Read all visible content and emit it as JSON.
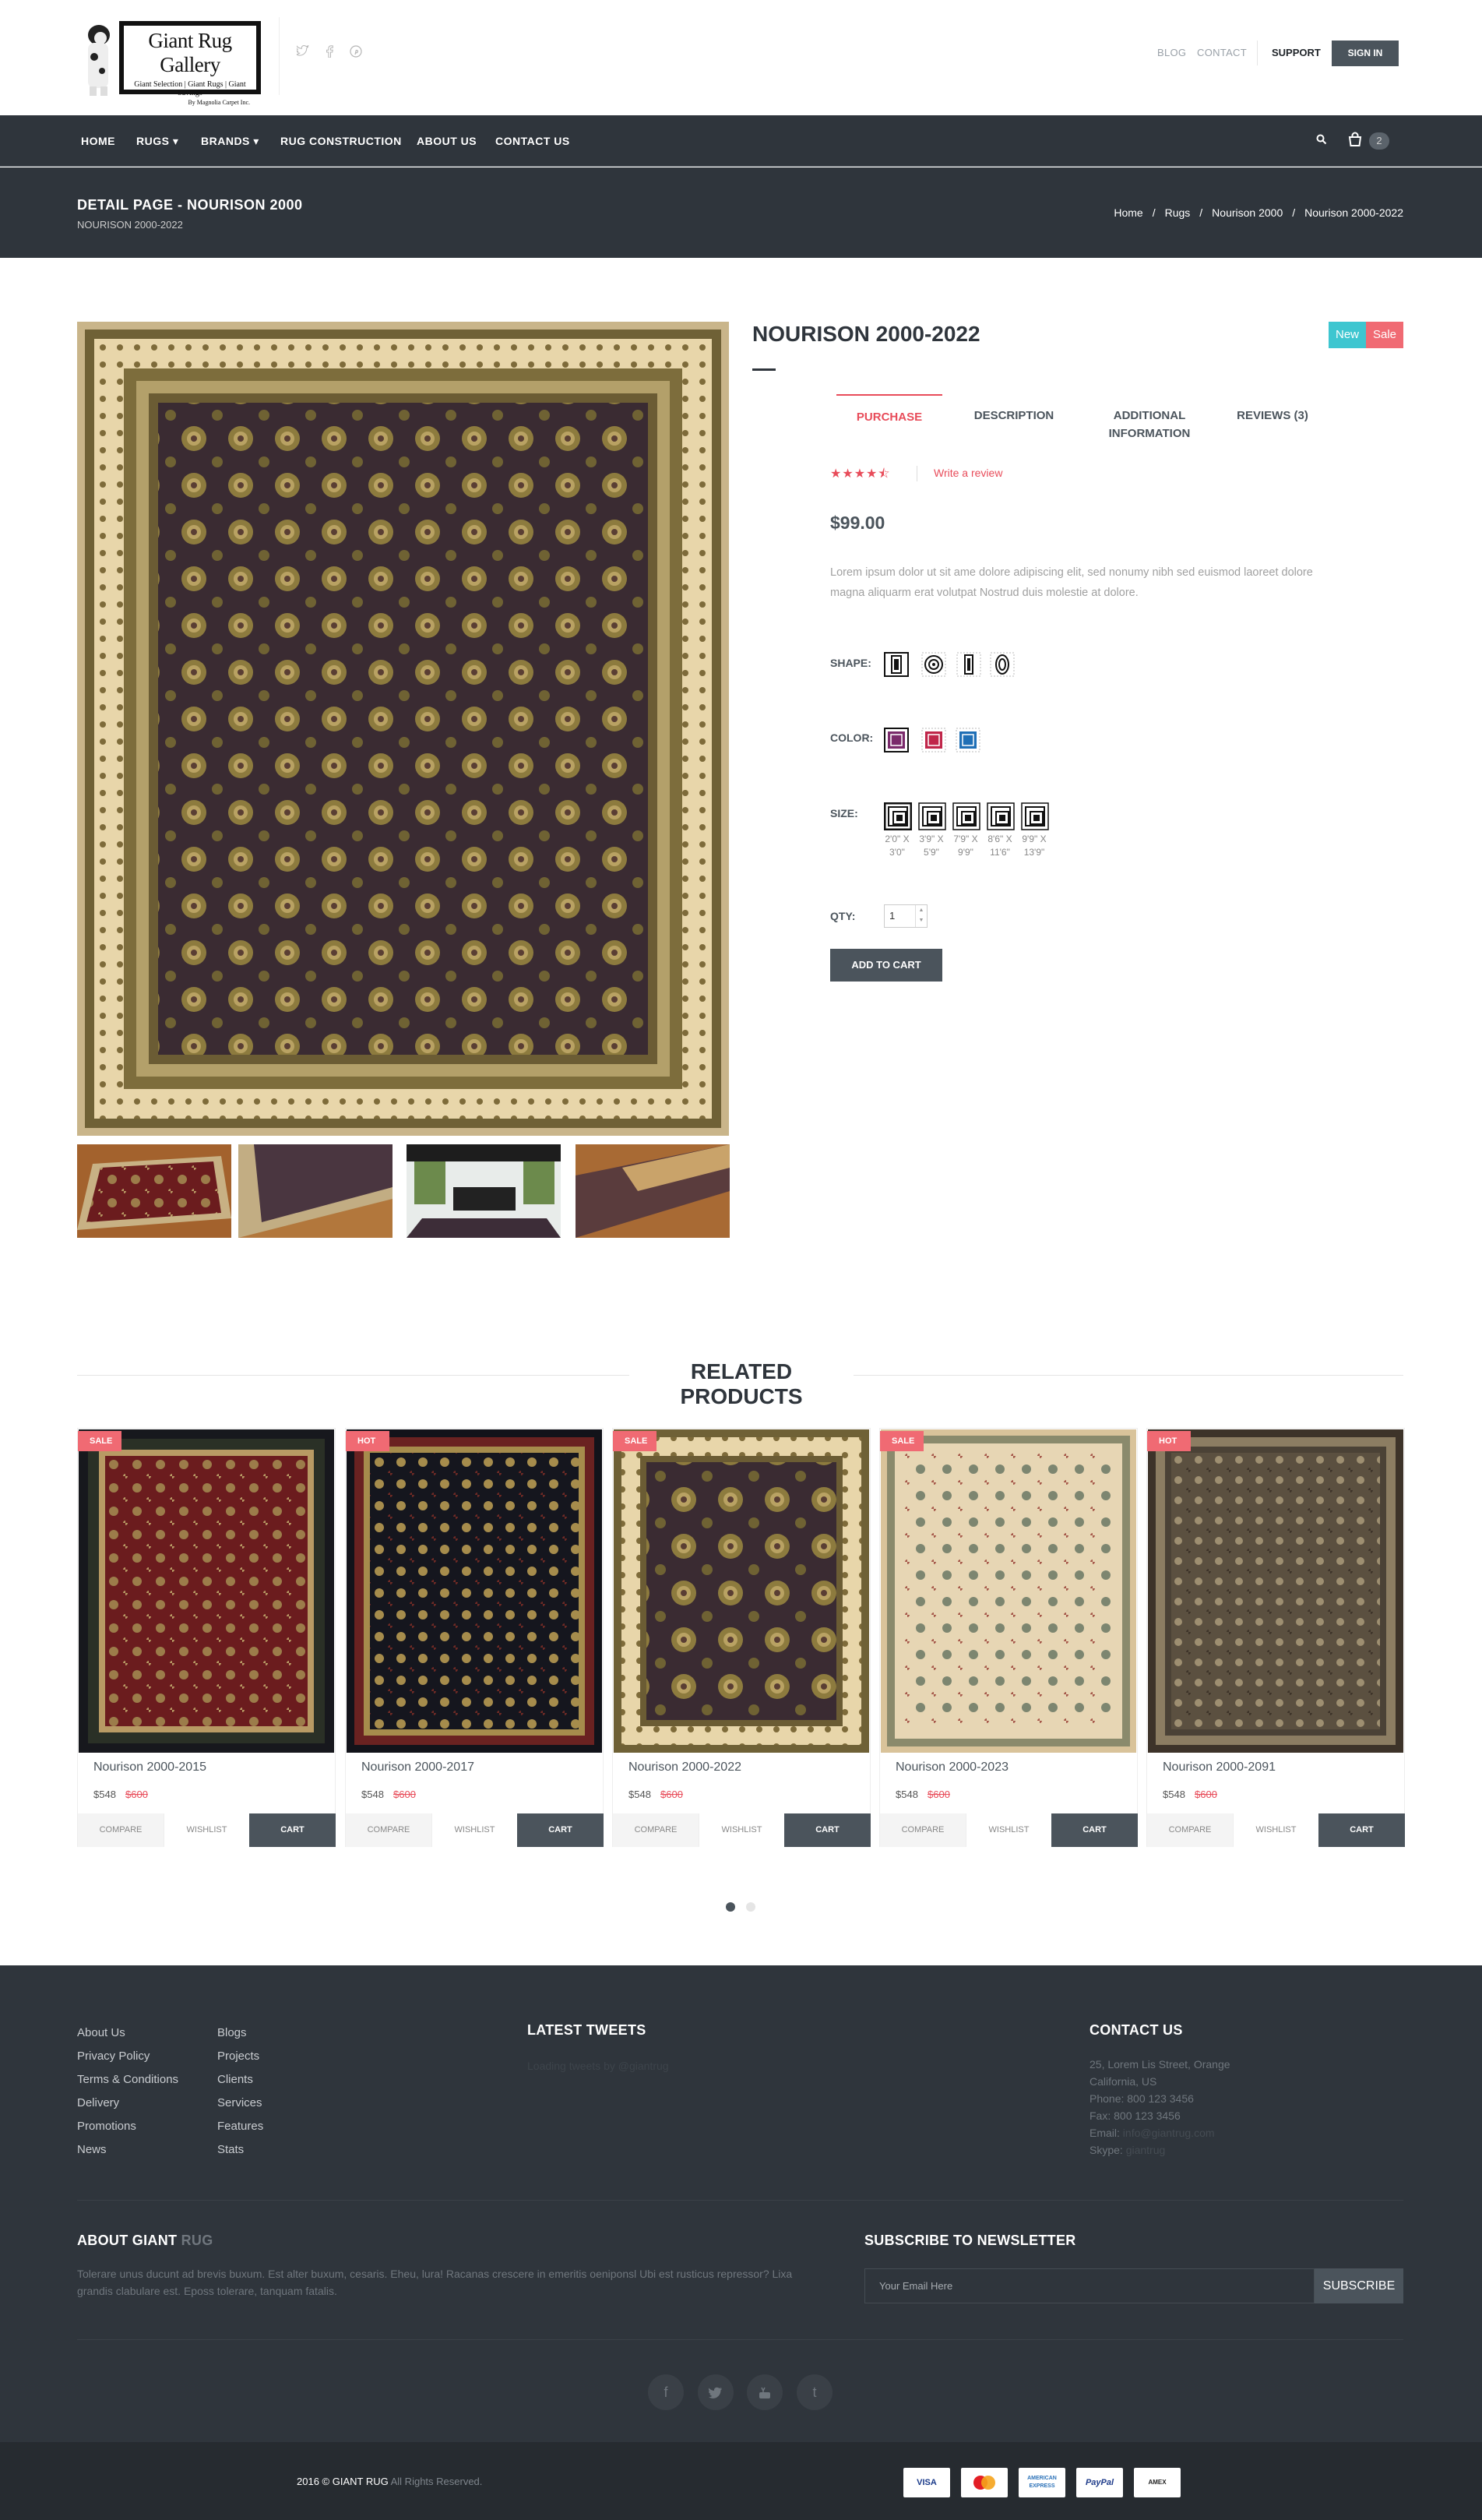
{
  "header": {
    "logo": {
      "brand": "Giant Rug Gallery",
      "tagline": "Giant Selection | Giant Rugs | Giant Savings",
      "byline": "By Magnolia Carpet Inc."
    },
    "social_icons": [
      "twitter-icon",
      "facebook-icon",
      "pinterest-icon"
    ],
    "links": {
      "blog": "BLOG",
      "contact": "CONTACT",
      "support": "SUPPORT",
      "sign_in": "SIGN IN"
    }
  },
  "nav": {
    "items": [
      {
        "label": "HOME"
      },
      {
        "label": "RUGS ▾"
      },
      {
        "label": "BRANDS ▾"
      },
      {
        "label": "RUG CONSTRUCTION"
      },
      {
        "label": "ABOUT US"
      },
      {
        "label": "CONTACT US"
      }
    ],
    "cart_count": "2"
  },
  "title_bar": {
    "title": "DETAIL PAGE - NOURISON 2000",
    "subtitle": "NOURISON 2000-2022",
    "breadcrumb": [
      "Home",
      "Rugs",
      "Nourison 2000",
      "Nourison 2000-2022"
    ]
  },
  "product": {
    "title": "NOURISON 2000-2022",
    "badges": {
      "new": "New",
      "sale": "Sale"
    },
    "tabs": [
      "PURCHASE",
      "DESCRIPTION",
      "ADDITIONAL INFORMATION",
      "REVIEWS (3)"
    ],
    "rating": 4.5,
    "write_review": "Write a review",
    "price": "$99.00",
    "description": "Lorem ipsum dolor ut sit ame dolore adipiscing elit, sed nonumy nibh sed euismod laoreet dolore magna aliquarm erat volutpat Nostrud duis molestie at dolore.",
    "shape_label": "SHAPE:",
    "color_label": "COLOR:",
    "size_label": "SIZE:",
    "sizes": [
      "2'0\" X 3'0\"",
      "3'9\" X 5'9\"",
      "7'9\" X 9'9\"",
      "8'6\" X 11'6\"",
      "9'9\" X 13'9\""
    ],
    "qty_label": "QTY:",
    "qty_value": "1",
    "add_to_cart": "ADD TO CART",
    "colors": [
      "#7a2a6b",
      "#c0264a",
      "#1f6fb6"
    ]
  },
  "related": {
    "title": "RELATED PRODUCTS",
    "items": [
      {
        "badge": "SALE",
        "name": "Nourison 2000-2015",
        "price": "$548",
        "old_price": "$600"
      },
      {
        "badge": "HOT",
        "name": "Nourison 2000-2017",
        "price": "$548",
        "old_price": "$600"
      },
      {
        "badge": "SALE",
        "name": "Nourison 2000-2022",
        "price": "$548",
        "old_price": "$600"
      },
      {
        "badge": "SALE",
        "name": "Nourison 2000-2023",
        "price": "$548",
        "old_price": "$600"
      },
      {
        "badge": "HOT",
        "name": "Nourison 2000-2091",
        "price": "$548",
        "old_price": "$600"
      }
    ],
    "buttons": {
      "compare": "COMPARE",
      "wishlist": "WISHLIST",
      "cart": "CART"
    }
  },
  "footer": {
    "links_col1": [
      "About Us",
      "Privacy Policy",
      "Terms & Conditions",
      "Delivery",
      "Promotions",
      "News"
    ],
    "links_col2": [
      "Blogs",
      "Projects",
      "Clients",
      "Services",
      "Features",
      "Stats"
    ],
    "tweets_title": "LATEST TWEETS",
    "tweets_text": "Loading tweets by @giantrug",
    "contact_title": "CONTACT US",
    "contact": {
      "street": "25, Lorem Lis Street, Orange",
      "city": "California, US",
      "phone": "Phone: 800 123 3456",
      "fax": "Fax: 800 123 3456",
      "email_label": "Email:",
      "email": "info@giantrug.com",
      "skype_label": "Skype:",
      "skype": "giantrug"
    },
    "about_title_a": "ABOUT GIANT",
    "about_title_b": "RUG",
    "about_text": "Tolerare unus ducunt ad brevis buxum. Est alter buxum, cesaris. Eheu, lura! Racanas crescere in emeritis oeniponsl Ubi est rusticus repressor? Lixa grandis clabulare est. Eposs tolerare, tanquam fatalis.",
    "newsletter_title": "SUBSCRIBE TO NEWSLETTER",
    "email_placeholder": "Your Email Here",
    "subscribe": "SUBSCRIBE",
    "social_icons": [
      "facebook-icon",
      "twitter-icon",
      "youtube-icon",
      "tumblr-icon"
    ],
    "copyright": "2016 © GIANT RUG",
    "rights": "All Rights Reserved.",
    "payments": [
      "VISA",
      "Mastercard",
      "AMERICAN EXPRESS",
      "PayPal",
      "AMEX"
    ]
  }
}
